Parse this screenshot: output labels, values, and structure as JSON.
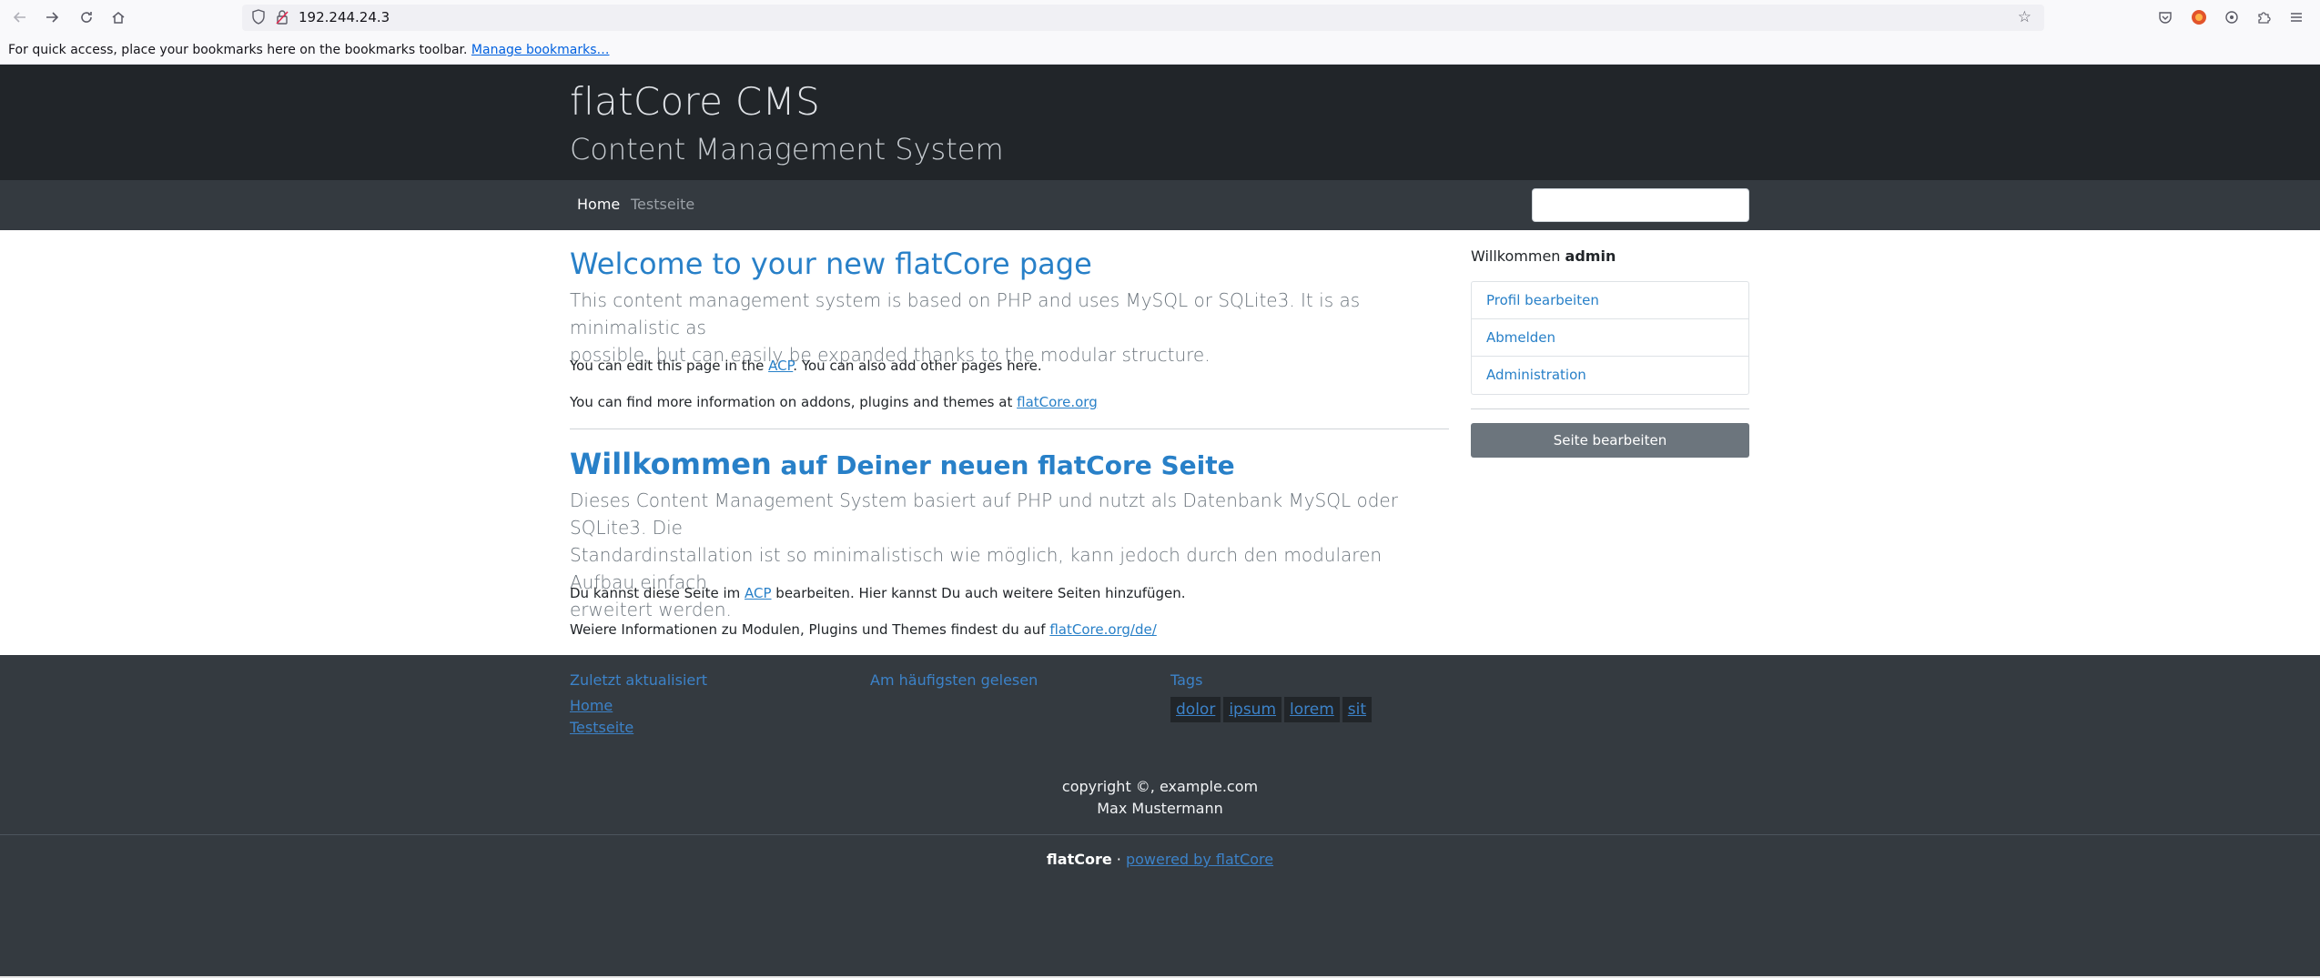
{
  "browser": {
    "url": "192.244.24.3",
    "bookmarks_text": "For quick access, place your bookmarks here on the bookmarks toolbar.",
    "bookmarks_link": "Manage bookmarks…"
  },
  "header": {
    "title": "flatCore CMS",
    "subtitle": "Content Management System"
  },
  "nav": {
    "items": [
      "Home",
      "Testseite"
    ],
    "search_value": ""
  },
  "content": {
    "en": {
      "heading": "Welcome to your new flatCore page",
      "lead_line1": "This content management system is based on PHP and uses MySQL or SQLite3. It is as minimalistic as",
      "lead_line2": "possible, but can easily be expanded thanks to the modular structure.",
      "p1_before": "You can edit this page in the ",
      "p1_link": "ACP",
      "p1_after": ". You can also add other pages here.",
      "p2_before": "You can find more information on addons, plugins and themes at ",
      "p2_link": "flatCore.org"
    },
    "de": {
      "heading_big": "Willkommen",
      "heading_small": " auf Deiner neuen flatCore Seite",
      "lead_line1": "Dieses Content Management System basiert auf PHP und nutzt als Datenbank MySQL oder SQLite3. Die",
      "lead_line2": "Standardinstallation ist so minimalistisch wie möglich, kann jedoch durch den modularen Aufbau einfach",
      "lead_line3": "erweitert werden.",
      "p1_before": "Du kannst diese Seite im ",
      "p1_link": "ACP",
      "p1_after": " bearbeiten. Hier kannst Du auch weitere Seiten hinzufügen.",
      "p2_before": "Weiere Informationen zu Modulen, Plugins und Themes findest du auf ",
      "p2_link": "flatCore.org/de/"
    }
  },
  "sidebar": {
    "welcome": "Willkommen",
    "username": "admin",
    "links": [
      "Profil bearbeiten",
      "Abmelden",
      "Administration"
    ],
    "edit_button": "Seite bearbeiten"
  },
  "footer": {
    "recent_heading": "Zuletzt aktualisiert",
    "recent_links": [
      "Home",
      "Testseite"
    ],
    "popular_heading": "Am häufigsten gelesen",
    "tags_heading": "Tags",
    "tags": [
      "dolor",
      "ipsum",
      "lorem",
      "sit"
    ],
    "copyright_line1": "copyright ©, example.com",
    "copyright_line2": "Max Mustermann",
    "brand": "flatCore",
    "separator": " · ",
    "powered": "powered by flatCore"
  },
  "icons": {
    "back": "arrow-left-icon",
    "forward": "arrow-right-icon",
    "reload": "reload-icon",
    "home": "home-icon",
    "shield": "shield-icon",
    "lock": "lock-icon",
    "star": "star-icon",
    "pocket": "pocket-icon",
    "account": "account-icon",
    "extensions": "puzzle-icon",
    "menu": "hamburger-menu-icon"
  }
}
